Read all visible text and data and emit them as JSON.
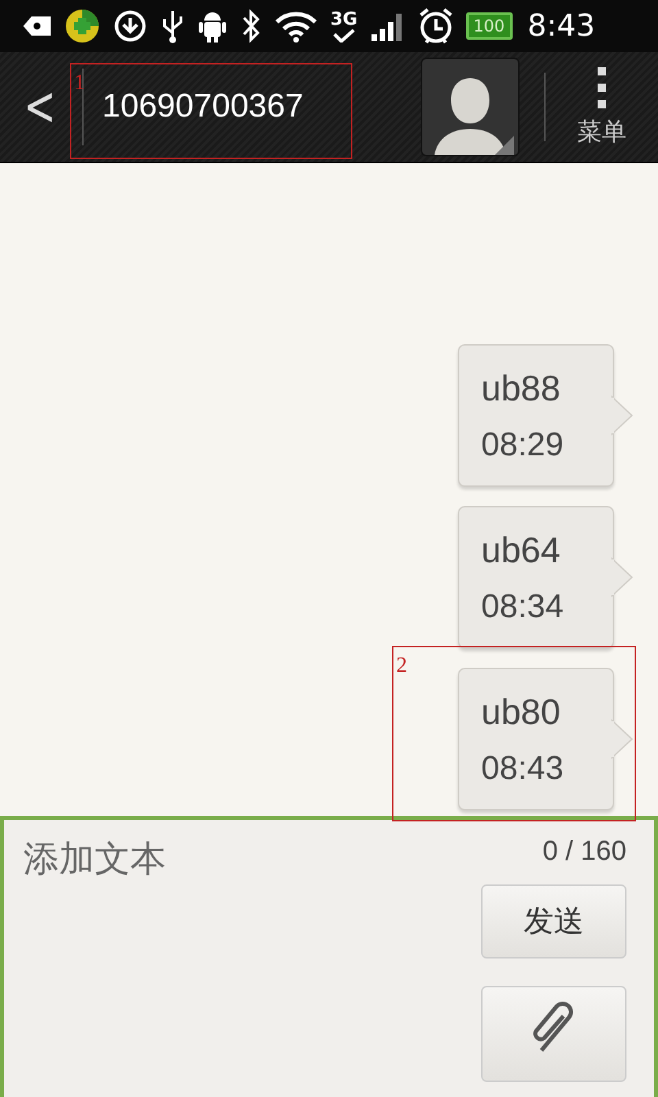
{
  "status_bar": {
    "network": "3G",
    "battery": "100",
    "time": "8:43"
  },
  "header": {
    "back": "<",
    "contact": "10690700367",
    "annotation": "1",
    "menu_label": "菜单"
  },
  "messages": [
    {
      "text": "ub88",
      "time": "08:29"
    },
    {
      "text": "ub64",
      "time": "08:34"
    },
    {
      "text": "ub80",
      "time": "08:43",
      "annotation": "2"
    }
  ],
  "compose": {
    "placeholder": "添加文本",
    "counter": "0 / 160",
    "send": "发送"
  }
}
